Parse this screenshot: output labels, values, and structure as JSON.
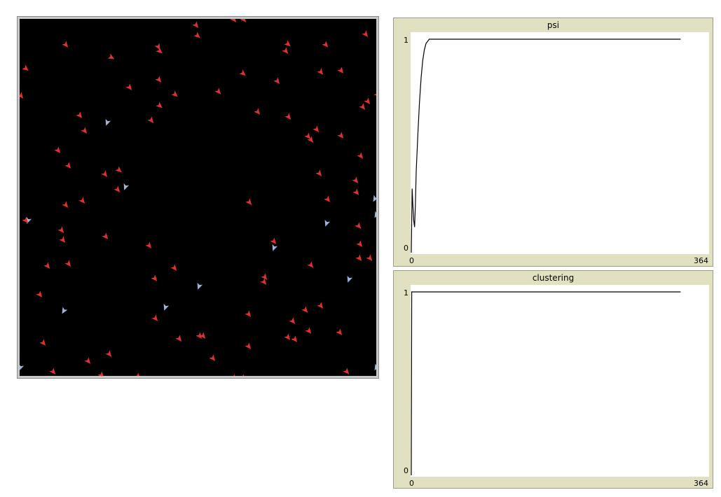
{
  "world": {
    "background": "#000000",
    "turtle_colors": {
      "red": "#e03030",
      "blue": "#9fb4d6"
    }
  },
  "plots": [
    {
      "title": "psi",
      "x_min_label": "0",
      "x_max_label": "364",
      "y_min_label": "0",
      "y_max_label": "1",
      "chart_data": {
        "type": "line",
        "title": "psi",
        "xlim": [
          0,
          364
        ],
        "ylim": [
          0,
          1
        ],
        "x": [
          0,
          1,
          2,
          3,
          4,
          5,
          6,
          8,
          10,
          12,
          14,
          16,
          18,
          20,
          22,
          25,
          28,
          32,
          40,
          60,
          100,
          150,
          200,
          250,
          300,
          330
        ],
        "y": [
          0,
          0.3,
          0.22,
          0.15,
          0.12,
          0.22,
          0.38,
          0.55,
          0.7,
          0.82,
          0.9,
          0.95,
          0.98,
          0.99,
          1.0,
          1.0,
          1.0,
          1.0,
          1.0,
          1.0,
          1.0,
          1.0,
          1.0,
          1.0,
          1.0,
          1.0
        ]
      }
    },
    {
      "title": "clustering",
      "x_min_label": "0",
      "x_max_label": "364",
      "y_min_label": "0",
      "y_max_label": "1",
      "chart_data": {
        "type": "line",
        "title": "clustering",
        "xlim": [
          0,
          364
        ],
        "ylim": [
          0,
          1
        ],
        "x": [
          0,
          0.5,
          330
        ],
        "y": [
          0,
          1,
          1
        ]
      }
    }
  ]
}
